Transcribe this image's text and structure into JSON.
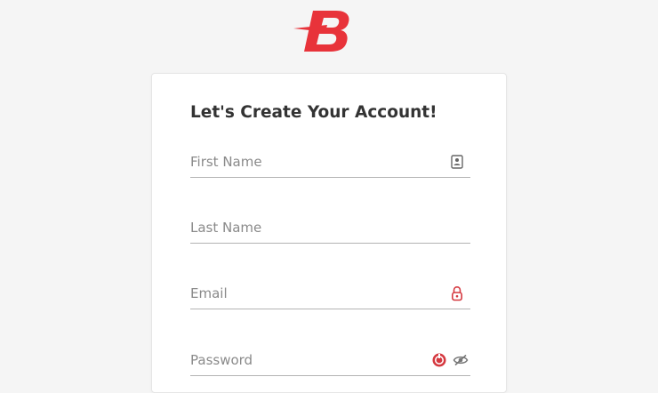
{
  "brand": {
    "logo_letter": "B",
    "color": "#e8333a"
  },
  "signup_form": {
    "title": "Let's Create Your Account!",
    "first_name": {
      "placeholder": "First Name",
      "value": "",
      "icon": "contact-card-icon"
    },
    "last_name": {
      "placeholder": "Last Name",
      "value": ""
    },
    "email": {
      "placeholder": "Email",
      "value": "",
      "icon": "padlock-icon"
    },
    "password": {
      "placeholder": "Password",
      "value": "",
      "icons": [
        "password-manager-icon",
        "eye-slash-icon"
      ]
    }
  }
}
